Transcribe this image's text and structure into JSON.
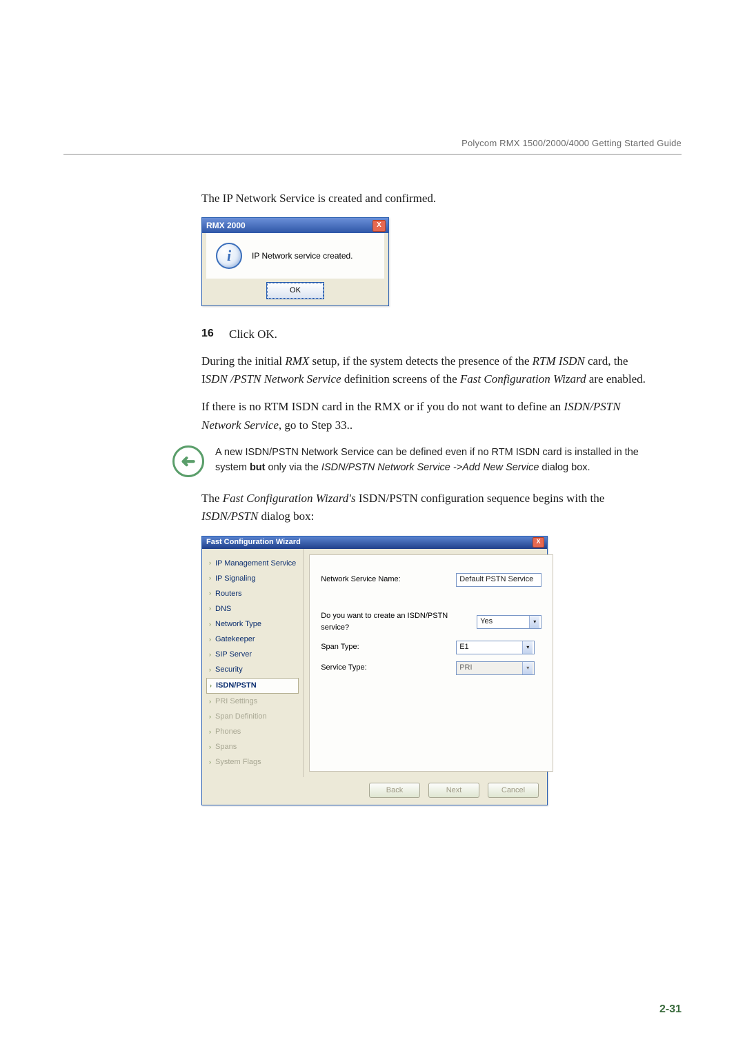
{
  "header": {
    "guide": "Polycom RMX 1500/2000/4000 Getting Started Guide"
  },
  "text": {
    "created_confirmed": "The IP Network Service is created and confirmed.",
    "step16_num": "16",
    "step16": "Click OK.",
    "para_initial_a": "During the initial ",
    "para_initial_b": " setup, if the system detects the presence of the ",
    "para_initial_c": " card, the I",
    "para_initial_d": " definition screens of the ",
    "para_initial_e": " are enabled.",
    "i_rmx": "RMX",
    "i_rtm": "RTM ISDN",
    "i_sdn": "SDN /PSTN Network Service",
    "i_fcw": "Fast Configuration Wizard",
    "para_nortm_a": "If there is no RTM ISDN card in the RMX or if you do not want to define an ",
    "para_nortm_b": ", go to Step 33..",
    "i_isdnpstn": "ISDN/PSTN Network Service",
    "note_a": "A new ISDN/PSTN Network Service can be defined even if no RTM ISDN card is installed in the system ",
    "note_but": "but",
    "note_b": " only via the ",
    "note_i1": "ISDN/PSTN Network Service ->Add New Service",
    "note_c": " dialog box.",
    "seq_a": "The ",
    "seq_i1": "Fast Configuration Wizard's",
    "seq_b": " ISDN/PSTN configuration sequence begins with the ",
    "seq_i2": "ISDN/PSTN",
    "seq_c": " dialog box:"
  },
  "win_dialog": {
    "title": "RMX 2000",
    "close": "X",
    "info_glyph": "i",
    "message": "IP Network service created.",
    "ok": "OK"
  },
  "wizard": {
    "title": "Fast Configuration Wizard",
    "close": "X",
    "nav": [
      {
        "label": "IP Management Service",
        "state": "completed"
      },
      {
        "label": "IP Signaling",
        "state": "completed"
      },
      {
        "label": "Routers",
        "state": "completed"
      },
      {
        "label": "DNS",
        "state": "completed"
      },
      {
        "label": "Network Type",
        "state": "completed"
      },
      {
        "label": "Gatekeeper",
        "state": "completed"
      },
      {
        "label": "SIP Server",
        "state": "completed"
      },
      {
        "label": "Security",
        "state": "completed"
      },
      {
        "label": "ISDN/PSTN",
        "state": "active"
      },
      {
        "label": "PRI Settings",
        "state": "disabled"
      },
      {
        "label": "Span Definition",
        "state": "disabled"
      },
      {
        "label": "Phones",
        "state": "disabled"
      },
      {
        "label": "Spans",
        "state": "disabled"
      },
      {
        "label": "System Flags",
        "state": "disabled"
      }
    ],
    "form": {
      "service_name_label": "Network Service Name:",
      "service_name_value": "Default PSTN Service",
      "create_label": "Do you want to create an ISDN/PSTN service?",
      "create_value": "Yes",
      "span_type_label": "Span Type:",
      "span_type_value": "E1",
      "service_type_label": "Service Type:",
      "service_type_value": "PRI"
    },
    "buttons": {
      "back": "Back",
      "next": "Next",
      "cancel": "Cancel"
    }
  },
  "pagenum": "2-31"
}
